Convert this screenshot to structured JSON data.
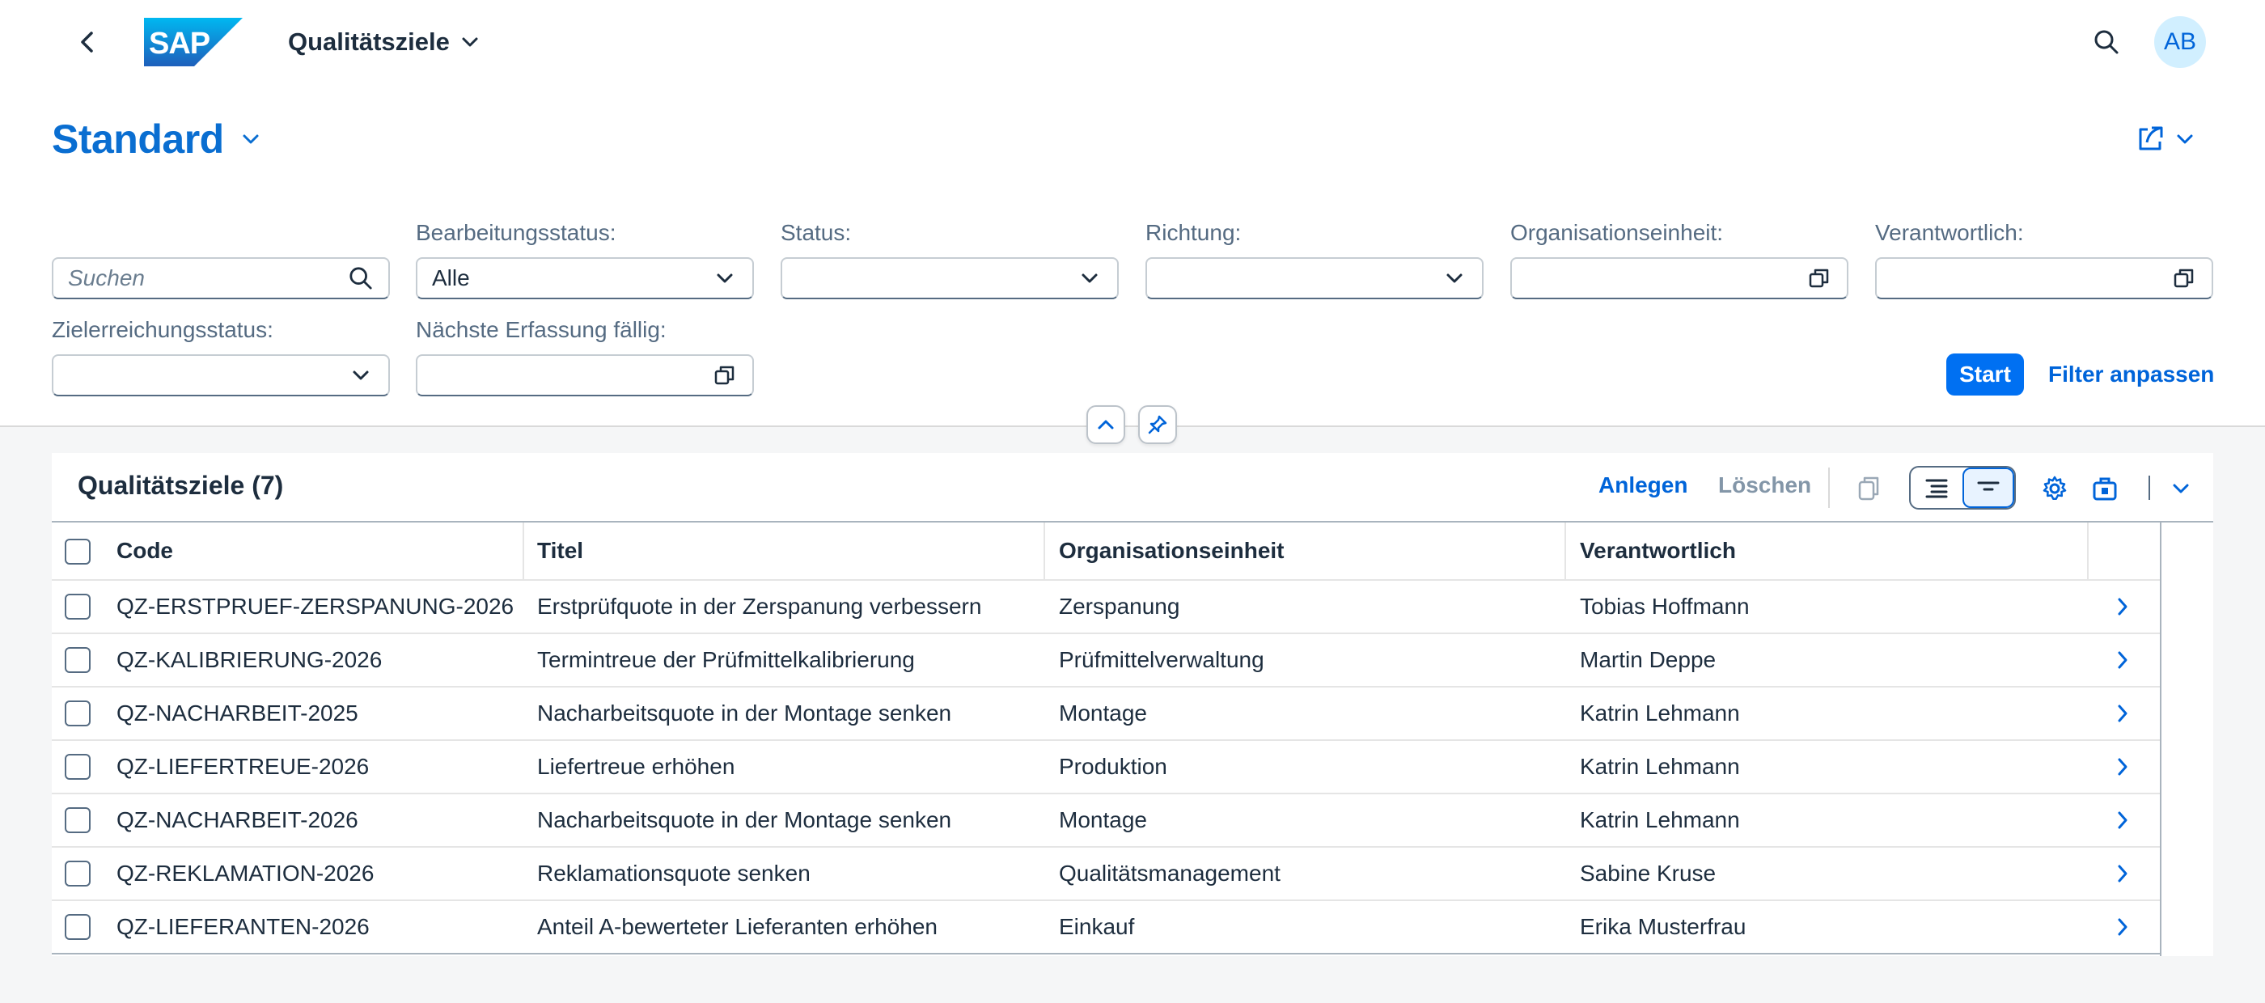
{
  "shell": {
    "logo_text": "SAP",
    "app_title": "Qualitätsziele",
    "avatar_initials": "AB"
  },
  "header": {
    "variant_title": "Standard"
  },
  "filters": {
    "search_placeholder": "Suchen",
    "bearbeitungsstatus_label": "Bearbeitungsstatus:",
    "bearbeitungsstatus_value": "Alle",
    "status_label": "Status:",
    "status_value": "",
    "richtung_label": "Richtung:",
    "richtung_value": "",
    "organisationseinheit_label": "Organisationseinheit:",
    "organisationseinheit_value": "",
    "verantwortlich_label": "Verantwortlich:",
    "verantwortlich_value": "",
    "zielerreichungsstatus_label": "Zielerreichungsstatus:",
    "zielerreichungsstatus_value": "",
    "naechste_erfassung_label": "Nächste Erfassung fällig:",
    "naechste_erfassung_value": "",
    "start_label": "Start",
    "adapt_label": "Filter anpassen"
  },
  "table": {
    "title": "Qualitätsziele (7)",
    "create_label": "Anlegen",
    "delete_label": "Löschen",
    "columns": [
      "Code",
      "Titel",
      "Organisationseinheit",
      "Verantwortlich"
    ],
    "rows": [
      [
        "QZ-ERSTPRUEF-ZERSPANUNG-2026",
        "Erstprüfquote in der Zerspanung verbessern",
        "Zerspanung",
        "Tobias Hoffmann"
      ],
      [
        "QZ-KALIBRIERUNG-2026",
        "Termintreue der Prüfmittelkalibrierung",
        "Prüfmittelverwaltung",
        "Martin Deppe"
      ],
      [
        "QZ-NACHARBEIT-2025",
        "Nacharbeitsquote in der Montage senken",
        "Montage",
        "Katrin Lehmann"
      ],
      [
        "QZ-LIEFERTREUE-2026",
        "Liefertreue erhöhen",
        "Produktion",
        "Katrin Lehmann"
      ],
      [
        "QZ-NACHARBEIT-2026",
        "Nacharbeitsquote in der Montage senken",
        "Montage",
        "Katrin Lehmann"
      ],
      [
        "QZ-REKLAMATION-2026",
        "Reklamationsquote senken",
        "Qualitätsmanagement",
        "Sabine Kruse"
      ],
      [
        "QZ-LIEFERANTEN-2026",
        "Anteil A-bewerteter Lieferanten erhöhen",
        "Einkauf",
        "Erika Musterfrau"
      ]
    ]
  },
  "colors": {
    "brand_blue": "#0070f2",
    "link_blue": "#0064d9",
    "variant_blue": "#0a6ed1",
    "disabled_text": "#8396a8"
  },
  "icons": {
    "back": "back-arrow-icon",
    "search": "search-icon",
    "share": "share-icon",
    "value_help": "value-help-icon",
    "dropdown": "chevron-down-icon",
    "collapse": "chevron-up-icon",
    "pin": "pin-icon",
    "copy": "copy-icon",
    "settings": "gear-icon",
    "export": "export-icon",
    "navigation": "chevron-right-icon"
  }
}
